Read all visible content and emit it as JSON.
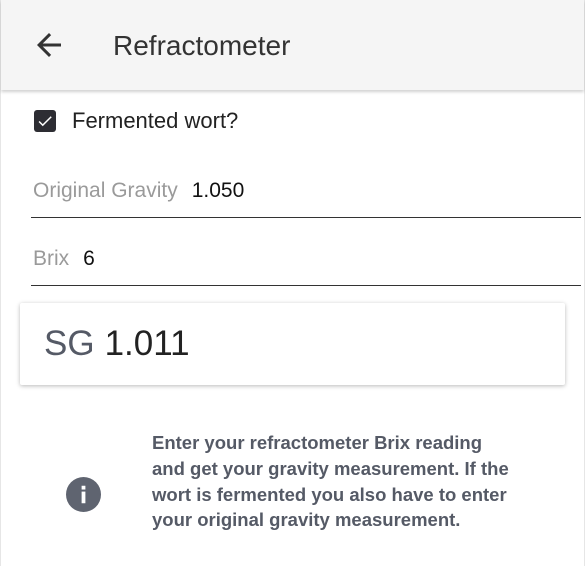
{
  "app_bar": {
    "back_icon": "arrow-left-icon",
    "title": "Refractometer"
  },
  "fermented": {
    "label": "Fermented wort?",
    "checked": true
  },
  "original_gravity": {
    "label": "Original Gravity",
    "value": "1.050"
  },
  "brix": {
    "label": "Brix",
    "value": "6"
  },
  "result": {
    "prefix": "SG",
    "value": "1.011"
  },
  "info": {
    "icon": "info-icon",
    "text": "Enter your refractometer Brix reading and get your gravity measurement. If the wort is fermented you also have to enter your original gravity measurement."
  },
  "colors": {
    "app_bar_bg": "#f5f5f5",
    "checkbox_fill": "#2d2d33",
    "info_text": "#555a66"
  }
}
